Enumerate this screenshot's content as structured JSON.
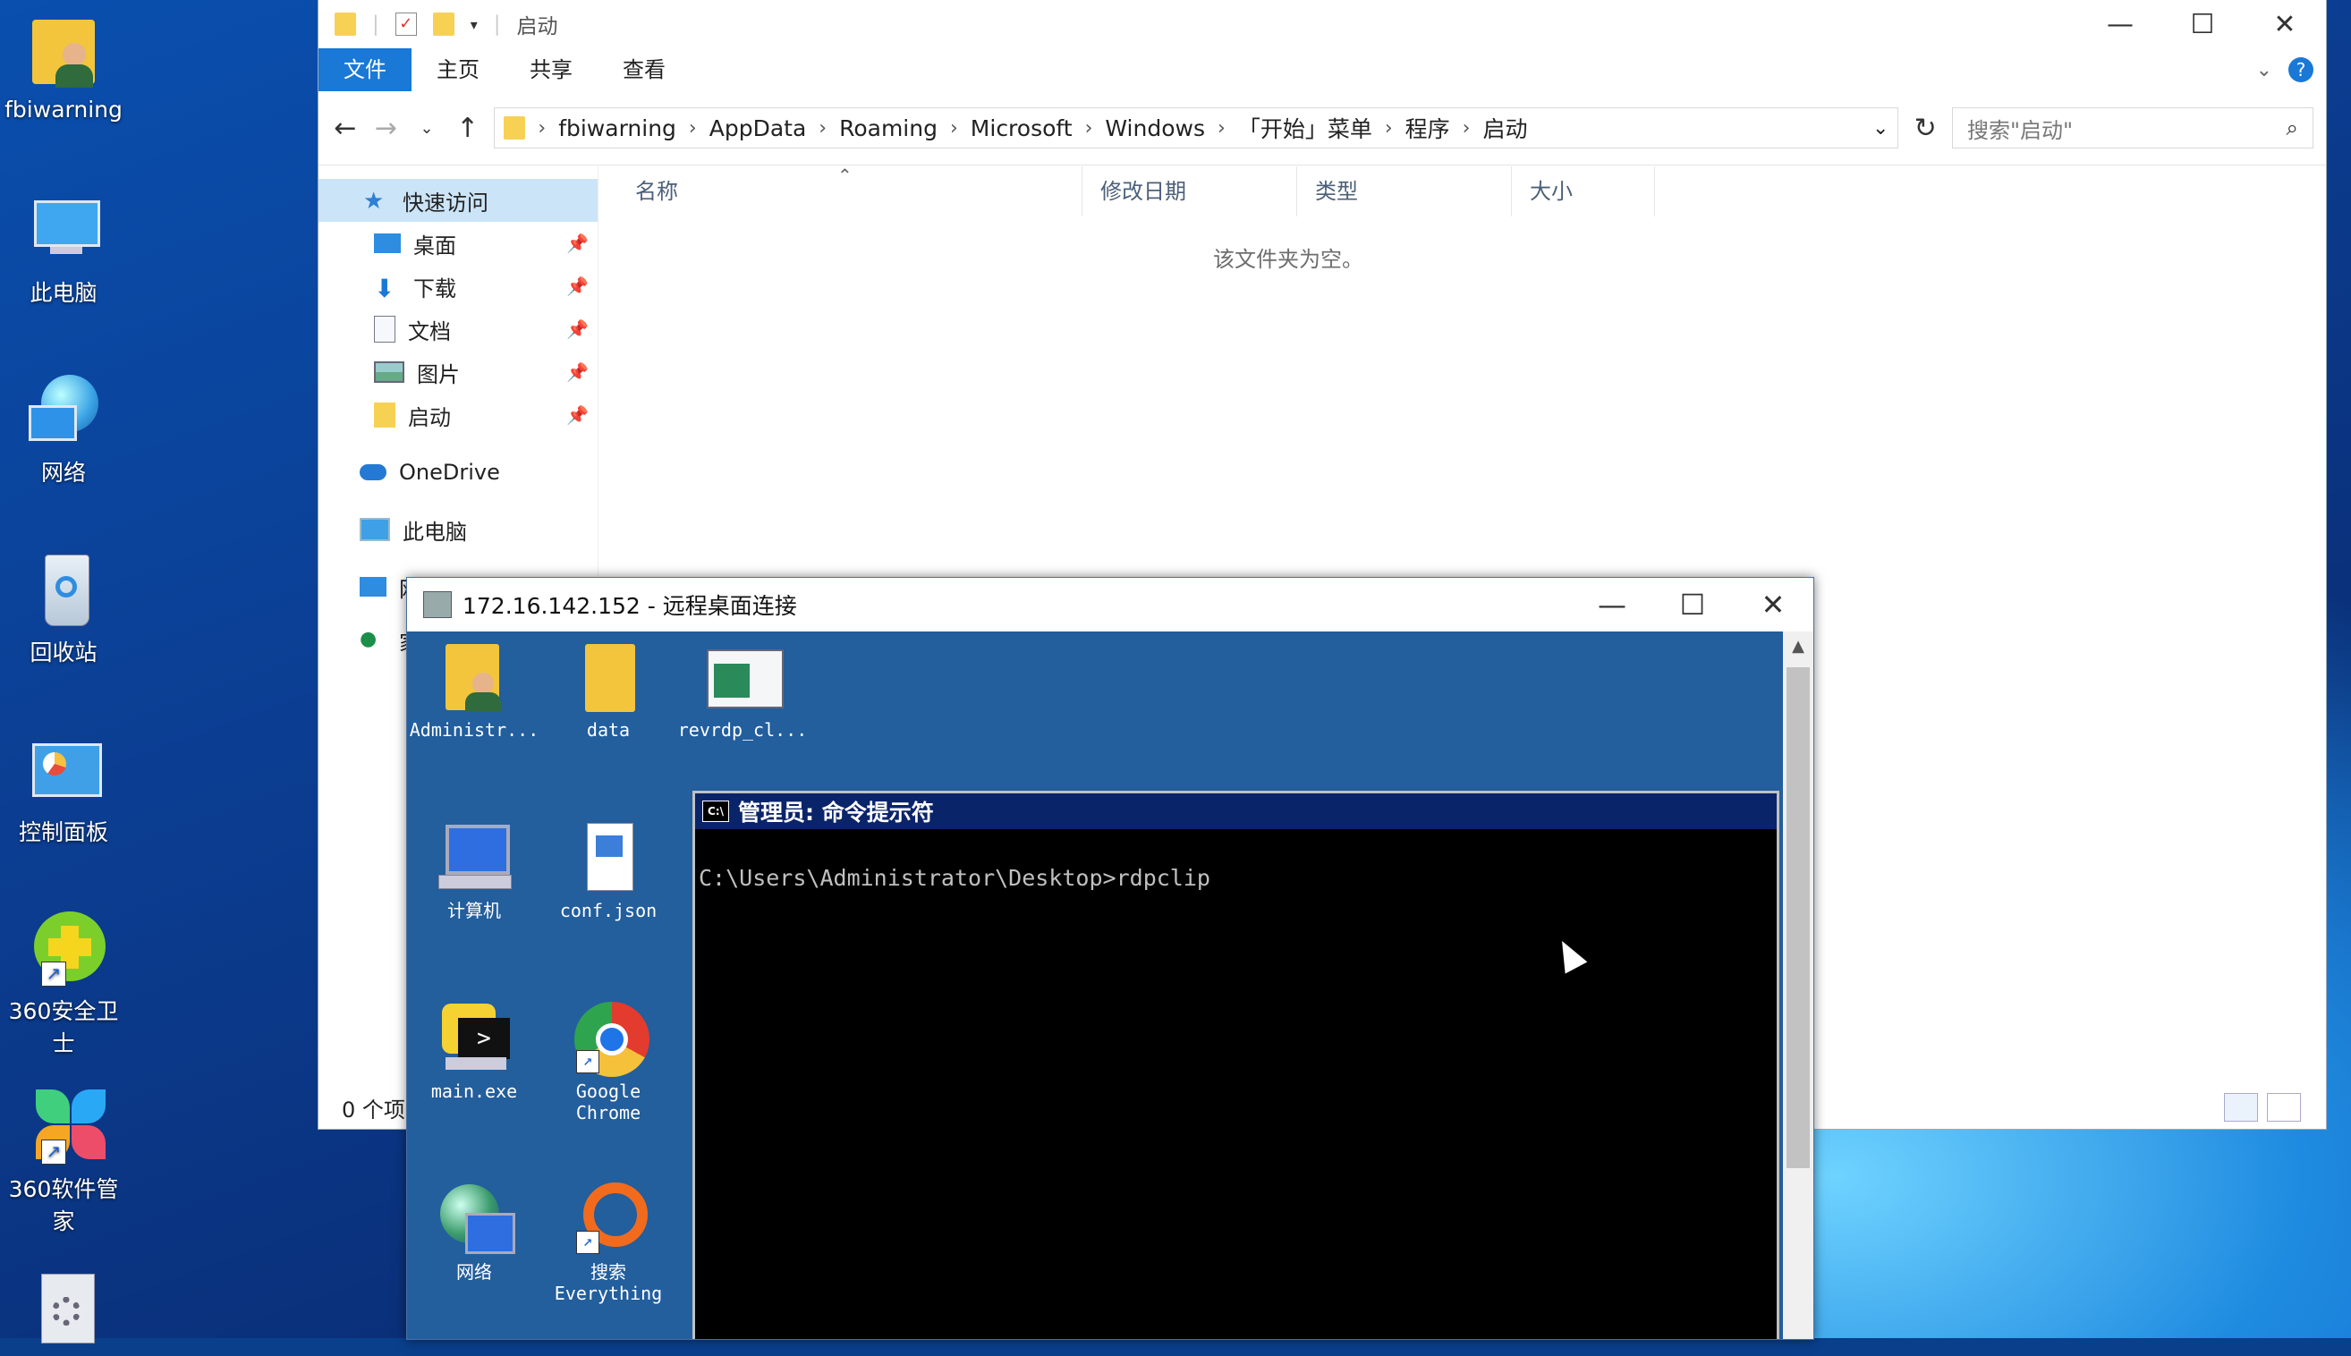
{
  "desktop": {
    "icons": [
      {
        "label": "fbiwarning",
        "icon": "user-folder-icon"
      },
      {
        "label": "此电脑",
        "icon": "computer-icon"
      },
      {
        "label": "网络",
        "icon": "network-icon"
      },
      {
        "label": "回收站",
        "icon": "recycle-bin-icon"
      },
      {
        "label": "控制面板",
        "icon": "control-panel-icon"
      },
      {
        "label": "360安全卫士",
        "icon": "360-security-icon"
      },
      {
        "label": "360软件管家",
        "icon": "360-software-icon"
      }
    ]
  },
  "explorer": {
    "title": "启动",
    "ribbon": {
      "file": "文件",
      "home": "主页",
      "share": "共享",
      "view": "查看"
    },
    "address": [
      "fbiwarning",
      "AppData",
      "Roaming",
      "Microsoft",
      "Windows",
      "「开始」菜单",
      "程序",
      "启动"
    ],
    "search_placeholder": "搜索\"启动\"",
    "nav": {
      "quick_access": "快速访问",
      "desktop": "桌面",
      "downloads": "下载",
      "documents": "文档",
      "pictures": "图片",
      "startup": "启动",
      "onedrive": "OneDrive",
      "this_pc": "此电脑",
      "network_partial": "网",
      "homegroup_partial": "家"
    },
    "columns": {
      "name": "名称",
      "date": "修改日期",
      "type": "类型",
      "size": "大小"
    },
    "empty_text": "该文件夹为空。",
    "status": "0 个项"
  },
  "rdp": {
    "title": "172.16.142.152 - 远程桌面连接",
    "icons": [
      {
        "label": "Administr...",
        "icon": "user-folder-icon"
      },
      {
        "label": "data",
        "icon": "folder-icon"
      },
      {
        "label": "revrdp_cl...",
        "icon": "window-app-icon"
      },
      {
        "label": "计算机",
        "icon": "computer-icon"
      },
      {
        "label": "conf.json",
        "icon": "document-icon"
      },
      {
        "label": "main.exe",
        "icon": "python-exe-icon"
      },
      {
        "label": "Google Chrome",
        "icon": "chrome-icon"
      },
      {
        "label": "网络",
        "icon": "network-icon"
      },
      {
        "label": "搜索 Everything",
        "icon": "everything-icon"
      }
    ],
    "cmd": {
      "title": "管理员: 命令提示符",
      "line": "C:\\Users\\Administrator\\Desktop>rdpclip"
    }
  },
  "colors": {
    "accent": "#1a78d6",
    "remote_bg": "#235e9d",
    "cmd_title": "#0a246a"
  }
}
